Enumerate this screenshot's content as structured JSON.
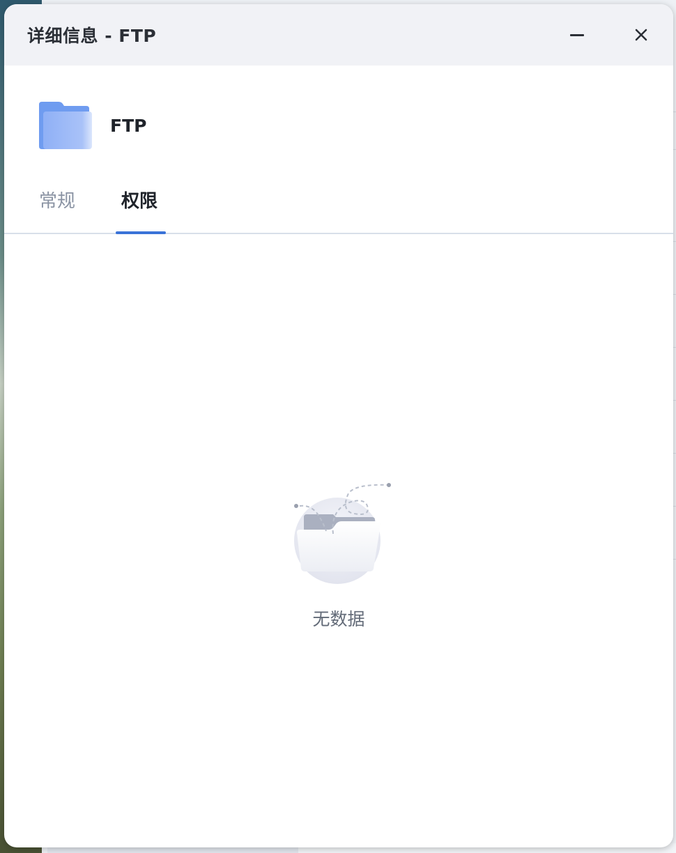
{
  "window": {
    "title": "详细信息 - FTP"
  },
  "file": {
    "name": "FTP",
    "icon": "folder-icon",
    "icon_color": "#6f9cf0"
  },
  "tabs": [
    {
      "label": "常规",
      "active": false
    },
    {
      "label": "权限",
      "active": true
    }
  ],
  "accent_color": "#3a73d8",
  "empty_state": {
    "text": "无数据",
    "icon": "empty-folder-icon"
  }
}
